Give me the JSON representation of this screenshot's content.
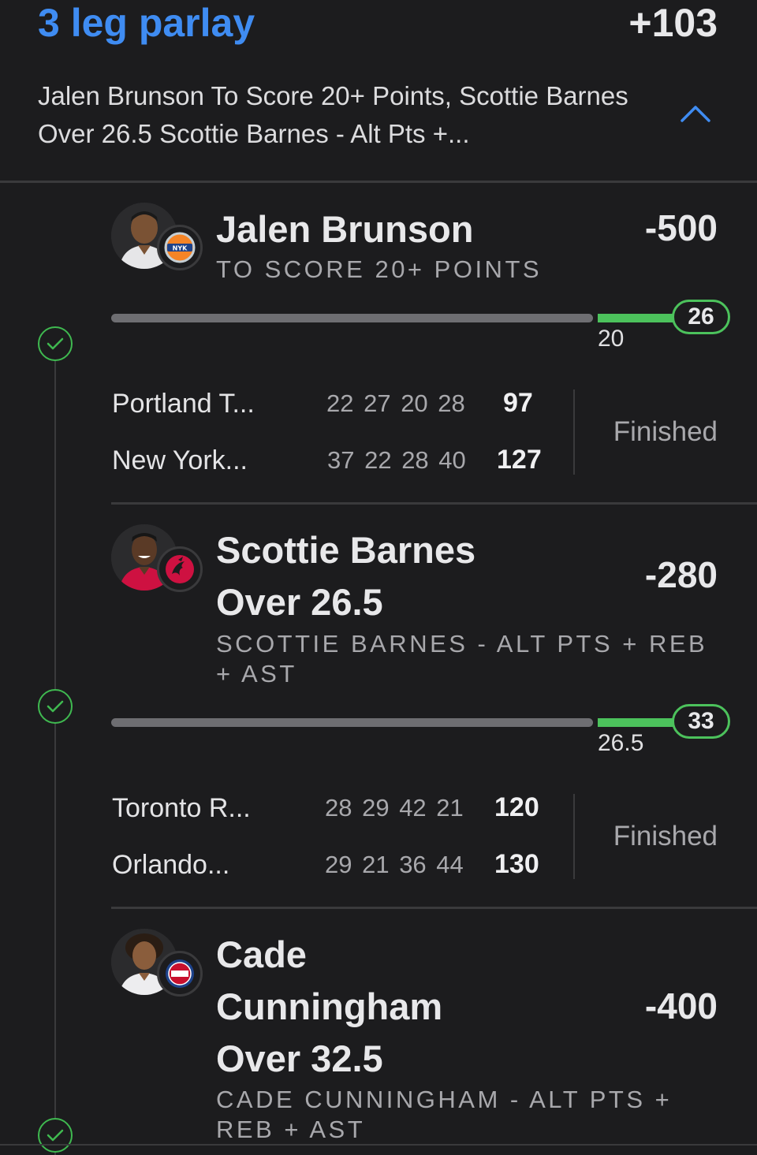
{
  "parlay": {
    "title": "3 leg parlay",
    "odds": "+103",
    "description": "Jalen Brunson To Score 20+ Points, Scottie Barnes Over 26.5 Scottie Barnes - Alt Pts +..."
  },
  "icons": {
    "collapse": "chevron-up-icon",
    "leg_status": "check-circle-icon"
  },
  "colors": {
    "accent_blue": "#3f8cf2",
    "win_green": "#4cc25c",
    "background": "#1c1c1e"
  },
  "legs": [
    {
      "player": "Jalen Brunson",
      "team_logo": "knicks-logo",
      "market": "TO SCORE 20+ POINTS",
      "odds": "-500",
      "progress": {
        "current": "26",
        "threshold": "20"
      },
      "game": {
        "teams": [
          {
            "name": "Portland T...",
            "quarters": "22 27 20 28",
            "total": "97"
          },
          {
            "name": "New York...",
            "quarters": "37 22 28 40",
            "total": "127"
          }
        ],
        "status": "Finished"
      }
    },
    {
      "player": "Scottie Barnes Over 26.5",
      "player_line1": "Scottie Barnes",
      "player_line2": "Over 26.5",
      "team_logo": "raptors-logo",
      "market": "SCOTTIE BARNES - ALT PTS + REB + AST",
      "odds": "-280",
      "progress": {
        "current": "33",
        "threshold": "26.5"
      },
      "game": {
        "teams": [
          {
            "name": "Toronto R...",
            "quarters": "28 29 42 21",
            "total": "120"
          },
          {
            "name": "Orlando...",
            "quarters": "29 21 36 44",
            "total": "130"
          }
        ],
        "status": "Finished"
      }
    },
    {
      "player": "Cade Cunningham Over 32.5",
      "player_line1": "Cade",
      "player_line2": "Cunningham",
      "player_line3": "Over 32.5",
      "team_logo": "pistons-logo",
      "market": "CADE CUNNINGHAM - ALT PTS + REB + AST",
      "odds": "-400"
    }
  ]
}
